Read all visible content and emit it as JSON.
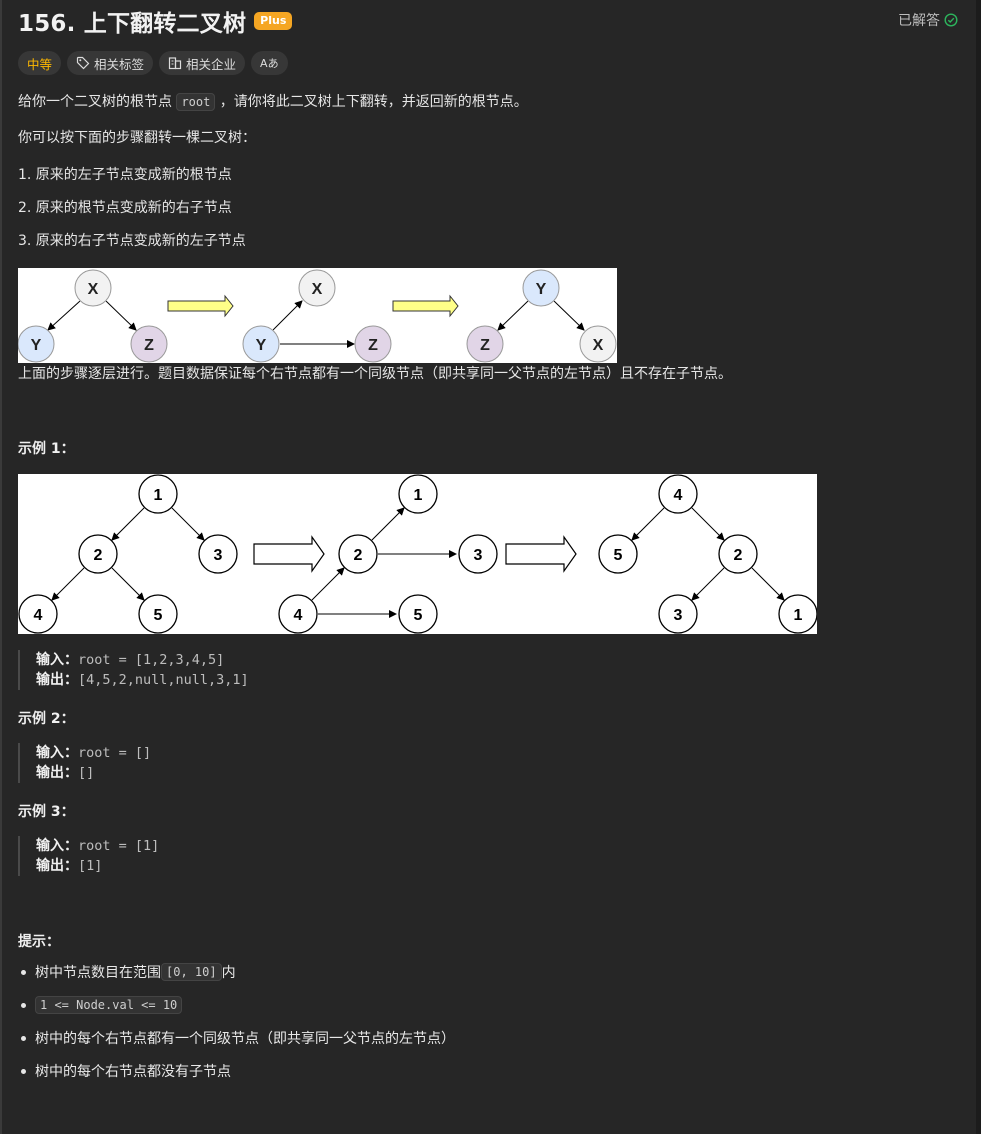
{
  "problem": {
    "title": "156. 上下翻转二叉树",
    "badge": "Plus",
    "solved": "已解答"
  },
  "tags": {
    "difficulty": "中等",
    "topics": "相关标签",
    "companies": "相关企业",
    "translate": "Aあ"
  },
  "description": {
    "p1_before": "给你一个二叉树的根节点 ",
    "p1_code": "root",
    "p1_after": " ，请你将此二叉树上下翻转，并返回新的根节点。",
    "p2": "你可以按下面的步骤翻转一棵二叉树：",
    "step1": "1. 原来的左子节点变成新的根节点",
    "step2": "2. 原来的根节点变成新的右子节点",
    "step3": "3. 原来的右子节点变成新的左子节点",
    "p3": "上面的步骤逐层进行。题目数据保证每个右节点都有一个同级节点（即共享同一父节点的左节点）且不存在子节点。"
  },
  "diagram1": {
    "x": "X",
    "y": "Y",
    "z": "Z"
  },
  "example1": {
    "heading": "示例 1：",
    "input_label": "输入：",
    "input": "root = [1,2,3,4,5]",
    "output_label": "输出：",
    "output": "[4,5,2,null,null,3,1]",
    "nodes": {
      "n1": "1",
      "n2": "2",
      "n3": "3",
      "n4": "4",
      "n5": "5"
    }
  },
  "example2": {
    "heading": "示例 2：",
    "input_label": "输入：",
    "input": "root = []",
    "output_label": "输出：",
    "output": "[]"
  },
  "example3": {
    "heading": "示例 3：",
    "input_label": "输入：",
    "input": "root = [1]",
    "output_label": "输出：",
    "output": "[1]"
  },
  "hints": {
    "heading": "提示：",
    "h1_before": "树中节点数目在范围 ",
    "h1_code": "[0, 10]",
    "h1_after": " 内",
    "h2_code": "1 <= Node.val <= 10",
    "h3": "树中的每个右节点都有一个同级节点（即共享同一父节点的左节点）",
    "h4": "树中的每个右节点都没有子节点"
  },
  "colors": {
    "background": "#262626",
    "plus_badge": "#f5a623",
    "difficulty": "#ffb800",
    "solved_check": "#2db55d",
    "node_gray": "#f2f2f2",
    "node_blue": "#dae8fc",
    "node_purple": "#e1d5e7",
    "arrow_yellow": "#ffff88"
  }
}
